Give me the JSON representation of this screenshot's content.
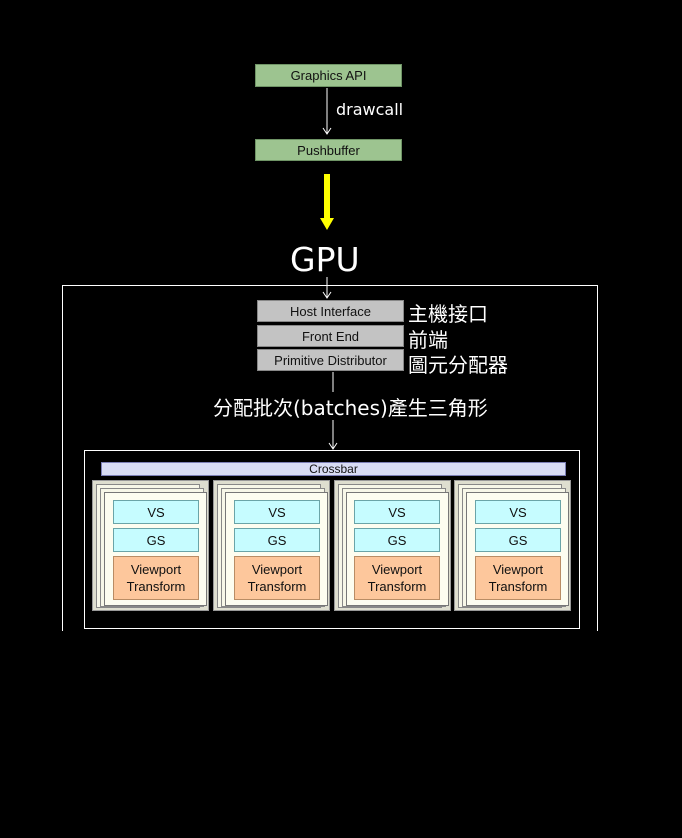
{
  "top_boxes": {
    "graphics_api": "Graphics API",
    "pushbuffer": "Pushbuffer"
  },
  "drawcall_label": "drawcall",
  "gpu_title": "GPU",
  "pipeline": [
    {
      "label": "Host Interface",
      "cn": "主機接口"
    },
    {
      "label": "Front End",
      "cn": "前端"
    },
    {
      "label": "Primitive Distributor",
      "cn": "圖元分配器"
    }
  ],
  "batch_label": "分配批次(batches)產生三角形",
  "crossbar_label": "Crossbar",
  "units": [
    {
      "vs": "VS",
      "gs": "GS",
      "vp_line1": "Viewport",
      "vp_line2": "Transform"
    },
    {
      "vs": "VS",
      "gs": "GS",
      "vp_line1": "Viewport",
      "vp_line2": "Transform"
    },
    {
      "vs": "VS",
      "gs": "GS",
      "vp_line1": "Viewport",
      "vp_line2": "Transform"
    },
    {
      "vs": "VS",
      "gs": "GS",
      "vp_line1": "Viewport",
      "vp_line2": "Transform"
    }
  ],
  "colors": {
    "background": "#000000",
    "stage_green": "#9dc490",
    "stage_gray": "#c3c3c3",
    "highlight_arrow": "#ffff00",
    "vs_gs_cyan": "#c6fcff",
    "viewport_orange": "#fdc79c",
    "crossbar_lavender": "#d8dcf4"
  }
}
